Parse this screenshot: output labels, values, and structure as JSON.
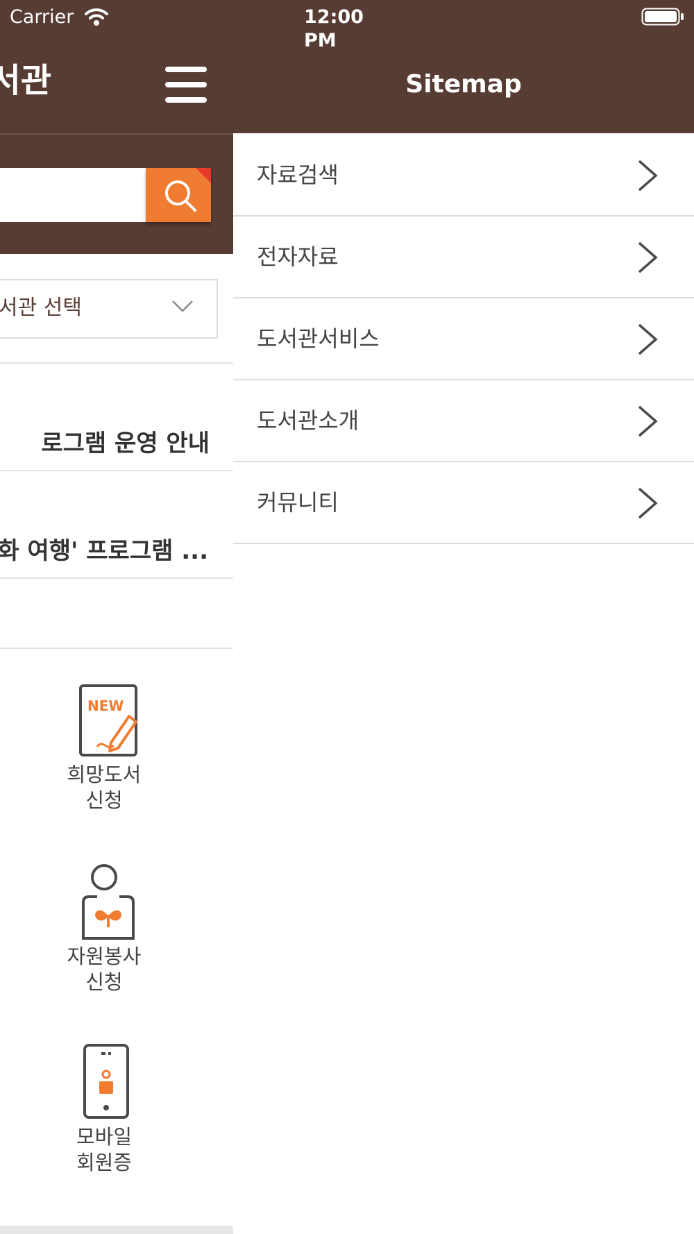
{
  "status_bar": {
    "carrier": "Carrier",
    "time": "12:00 PM",
    "icons": [
      "wifi-icon",
      "battery-icon"
    ]
  },
  "background_page": {
    "title_fragment": "서관",
    "library_select": {
      "selected": "서관 선택"
    },
    "notices": [
      "로그램 운영 안내",
      "화 여행' 프로그램 ..."
    ],
    "quick_menu": [
      {
        "icon": "new-request-icon",
        "line1": "희망도서",
        "line2": "신청"
      },
      {
        "icon": "volunteer-icon",
        "line1": "자원봉사",
        "line2": "신청"
      },
      {
        "icon": "mobile-card-icon",
        "line1": "모바일",
        "line2": "회원증"
      }
    ],
    "icon_text": {
      "new_badge": "NEW"
    }
  },
  "sitemap": {
    "title": "Sitemap",
    "items": [
      {
        "label": "자료검색"
      },
      {
        "label": "전자자료"
      },
      {
        "label": "도서관서비스"
      },
      {
        "label": "도서관소개"
      },
      {
        "label": "커뮤니티"
      }
    ]
  },
  "colors": {
    "header_brown": "#573c33",
    "accent_orange": "#ef7c30",
    "corner_red": "#e8392c",
    "divider": "#dcdcdc"
  }
}
